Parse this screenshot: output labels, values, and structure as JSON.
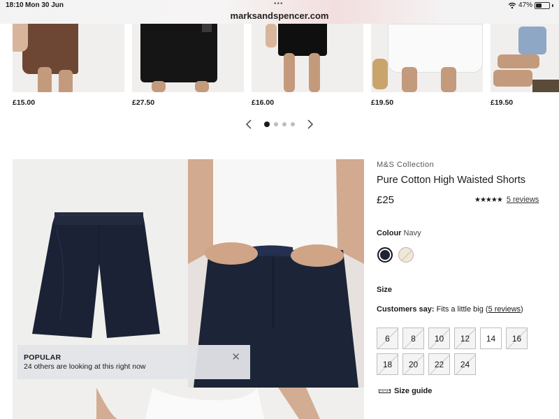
{
  "status_bar": {
    "time": "18:10",
    "date": "Mon 30 Jun",
    "url": "marksandspencer.com",
    "battery": "47%",
    "battery_level": 0.47
  },
  "carousel": {
    "items": [
      {
        "price": "£15.00"
      },
      {
        "price": "£27.50"
      },
      {
        "price": "£16.00"
      },
      {
        "price": "£19.50"
      },
      {
        "price": "£19.50"
      }
    ],
    "prev_icon": "chevron-left-icon",
    "next_icon": "chevron-right-icon",
    "page_count": 4,
    "active_page": 1
  },
  "popular": {
    "title": "POPULAR",
    "text": "24 others are looking at this right now",
    "close_icon": "close-icon"
  },
  "product": {
    "brand": "M&S Collection",
    "title": "Pure Cotton High Waisted Shorts",
    "price": "£25",
    "rating": 4.5,
    "reviews_link": "5 reviews",
    "colour_label": "Colour",
    "colour_value": "Navy",
    "colours": [
      {
        "name": "Navy",
        "hex": "#1e2436",
        "selected": true
      },
      {
        "name": "Cream",
        "hex": "#efe8d8",
        "selected": false
      }
    ],
    "size_label": "Size",
    "fit_prefix": "Customers say:",
    "fit_text": "Fits a little big (",
    "fit_link": "5 reviews",
    "fit_suffix": ")",
    "sizes": [
      {
        "label": "6",
        "available": false
      },
      {
        "label": "8",
        "available": false
      },
      {
        "label": "10",
        "available": false
      },
      {
        "label": "12",
        "available": false
      },
      {
        "label": "14",
        "available": true
      },
      {
        "label": "16",
        "available": false
      },
      {
        "label": "18",
        "available": false
      },
      {
        "label": "20",
        "available": false
      },
      {
        "label": "22",
        "available": false
      },
      {
        "label": "24",
        "available": false
      }
    ],
    "size_guide": "Size guide"
  }
}
